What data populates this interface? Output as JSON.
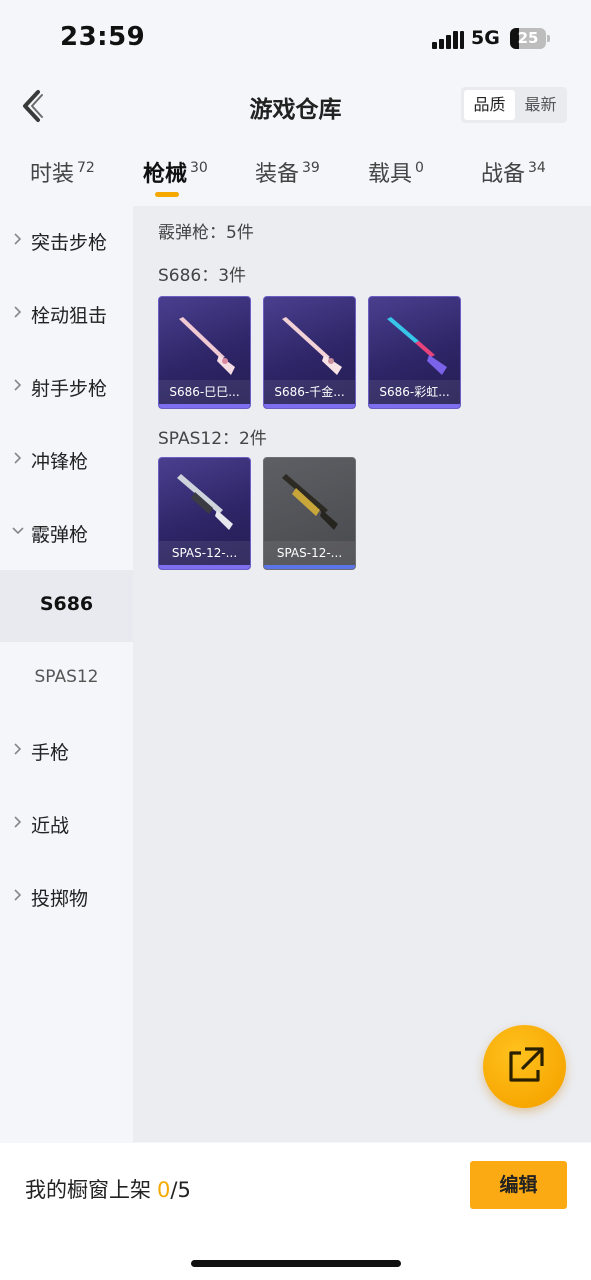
{
  "status_bar": {
    "time": "23:59",
    "network": "5G",
    "battery": "25"
  },
  "header": {
    "title": "游戏仓库",
    "sort_options": [
      "品质",
      "最新"
    ]
  },
  "tabs": [
    {
      "label": "时装",
      "count": "72"
    },
    {
      "label": "枪械",
      "count": "30"
    },
    {
      "label": "装备",
      "count": "39"
    },
    {
      "label": "载具",
      "count": "0"
    },
    {
      "label": "战备",
      "count": "34"
    }
  ],
  "active_tab": "枪械",
  "sidebar": {
    "categories": [
      "突击步枪",
      "栓动狙击",
      "射手步枪",
      "冲锋枪",
      "霰弹枪",
      "手枪",
      "近战",
      "投掷物"
    ],
    "subcategories": [
      "S686",
      "SPAS12"
    ],
    "selected_sub": "S686"
  },
  "content": {
    "category_summary": "霰弹枪：5件",
    "groups": [
      {
        "heading": "S686：3件",
        "items": [
          "S686-巳巳...",
          "S686-千金...",
          "S686-彩虹..."
        ]
      },
      {
        "heading": "SPAS12：2件",
        "items": [
          "SPAS-12-...",
          "SPAS-12-..."
        ]
      }
    ]
  },
  "footer": {
    "shelf_label": "我的橱窗上架",
    "shelf_count": "0",
    "shelf_total": "/5",
    "edit_label": "编辑"
  },
  "colors": {
    "accent": "#f5a800",
    "card_purple": "#2d2566",
    "card_gray": "#48494d"
  }
}
